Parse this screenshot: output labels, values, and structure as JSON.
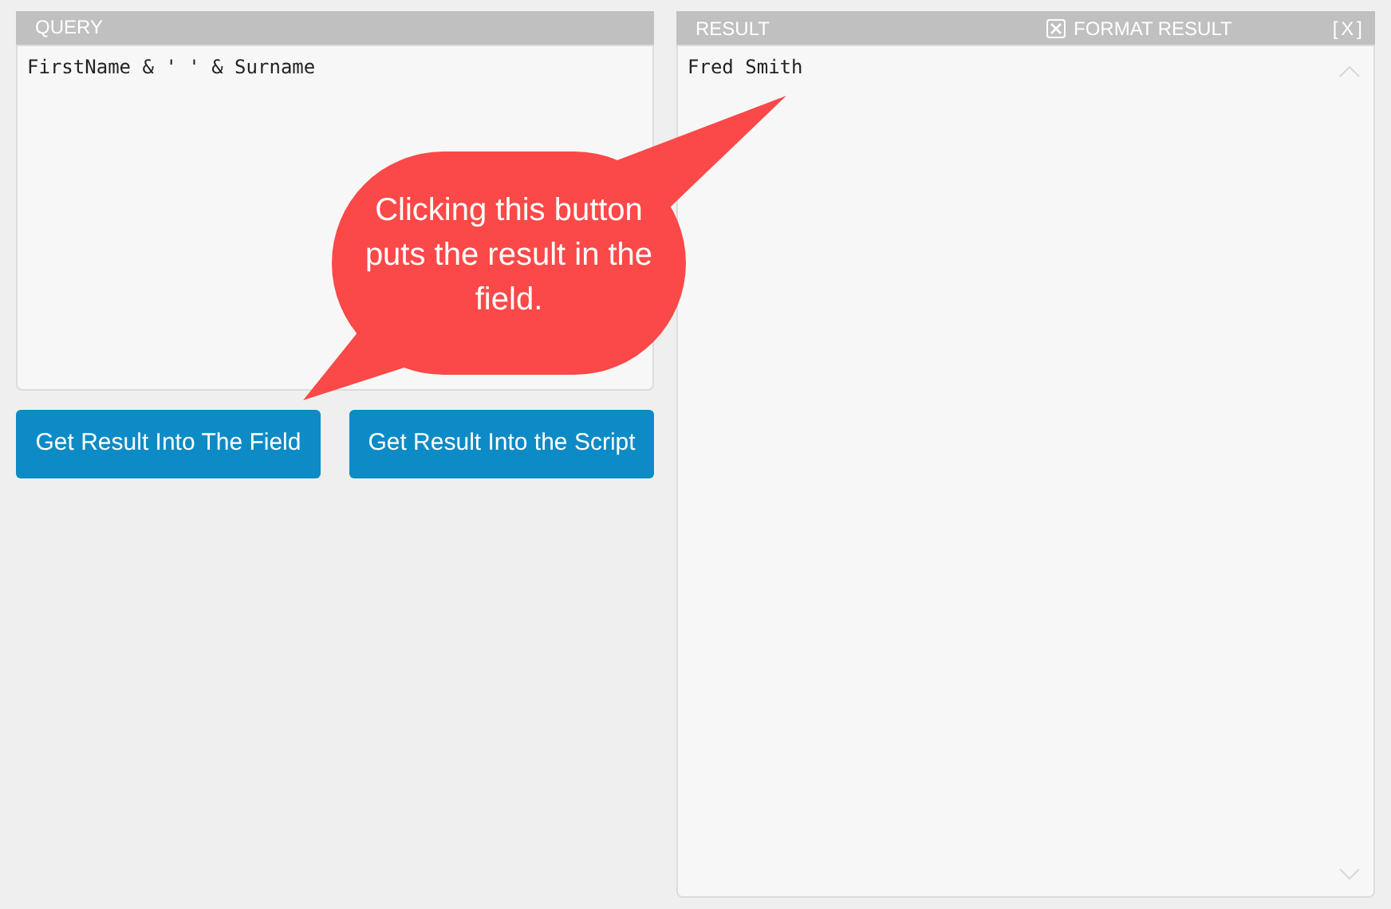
{
  "query": {
    "title": "QUERY",
    "value": "FirstName & ' ' & Surname"
  },
  "buttons": [
    {
      "label": "Get Result Into The Field"
    },
    {
      "label": "Get Result Into the Script"
    }
  ],
  "result": {
    "title": "RESULT",
    "format_result": {
      "label": "FORMAT RESULT",
      "checked": true
    },
    "close": "[X]",
    "value": "Fred Smith"
  },
  "callout": {
    "text": "Clicking this button puts the result in the field."
  }
}
